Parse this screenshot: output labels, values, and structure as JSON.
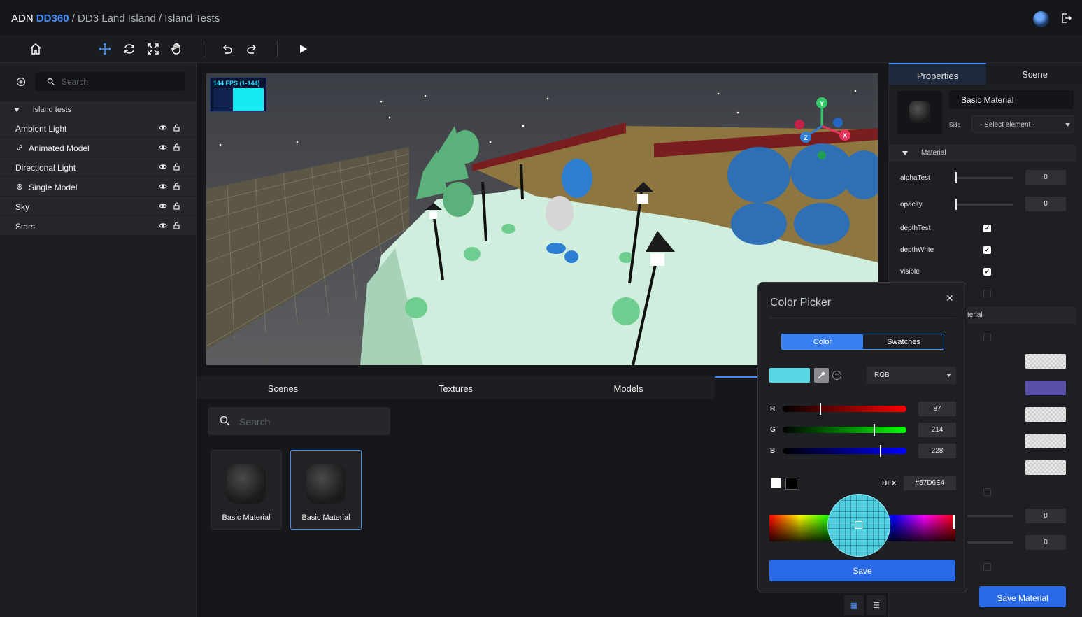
{
  "topbar": {
    "brand_prefix": "ADN ",
    "brand_product": "DD360",
    "breadcrumb": " / DD3 Land Island / Island Tests"
  },
  "icons": {
    "home": "home-icon",
    "move": "move-icon",
    "rotate": "rotate-icon",
    "scale": "scale-icon",
    "pan": "hand-icon",
    "undo": "undo-icon",
    "redo": "redo-icon",
    "play": "play-icon"
  },
  "scene_tree": {
    "search_placeholder": "Search",
    "root": "island tests",
    "items": [
      {
        "label": "Ambient Light",
        "icon": ""
      },
      {
        "label": "Animated Model",
        "icon": "link-icon"
      },
      {
        "label": "Directional Light",
        "icon": ""
      },
      {
        "label": "Single Model",
        "icon": "gear-icon"
      },
      {
        "label": "Sky",
        "icon": ""
      },
      {
        "label": "Stars",
        "icon": ""
      }
    ]
  },
  "viewport": {
    "fps": "144 FPS (1-144)",
    "gizmo_axes": [
      "Y",
      "Z",
      "X"
    ]
  },
  "assets": {
    "tabs": [
      "Scenes",
      "Textures",
      "Models"
    ],
    "search_placeholder": "Search",
    "cards": [
      "Basic Material",
      "Basic Material"
    ]
  },
  "properties": {
    "tabs": [
      "Properties",
      "Scene"
    ],
    "material_name": "Basic Material",
    "side_label": "Side",
    "side_select": "- Select element -",
    "section": "Material",
    "section2_partial": "terial",
    "rows": {
      "alphaTest": {
        "label": "alphaTest",
        "value": "0"
      },
      "opacity": {
        "label": "opacity",
        "value": "0"
      },
      "depthTest": {
        "label": "depthTest",
        "checked": true
      },
      "depthWrite": {
        "label": "depthWrite",
        "checked": true
      },
      "visible": {
        "label": "visible",
        "checked": true
      }
    },
    "lower_values": [
      "0",
      "0"
    ],
    "swatch_accent": "#5a4fa8",
    "save_button": "Save Material"
  },
  "color_picker": {
    "title": "Color Picker",
    "tabs": [
      "Color",
      "Swatches"
    ],
    "mode": "RGB",
    "r": {
      "label": "R",
      "value": "87"
    },
    "g": {
      "label": "G",
      "value": "214"
    },
    "b": {
      "label": "B",
      "value": "228"
    },
    "hex_label": "HEX",
    "hex": "#57D6E4",
    "save": "Save"
  }
}
